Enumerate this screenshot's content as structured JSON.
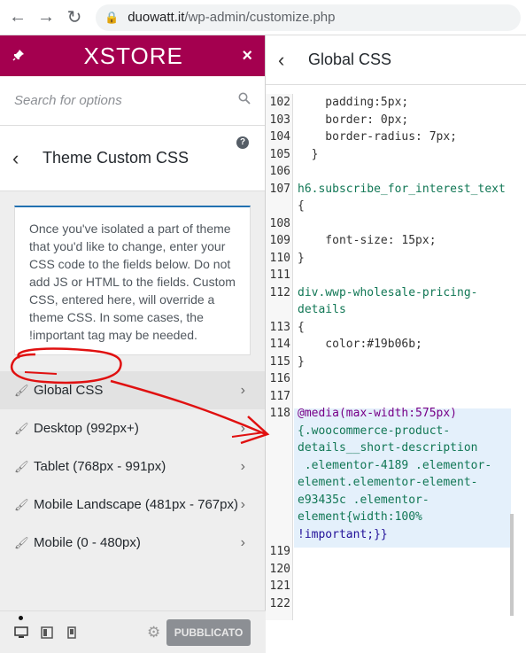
{
  "browser": {
    "back_icon": "←",
    "forward_icon": "→",
    "reload_icon": "↻",
    "domain": "duowatt.it",
    "path": "/wp-admin/customize.php"
  },
  "brand": {
    "logo": "XSTORE",
    "pin_icon": "pin-icon",
    "close_icon": "×",
    "color": "#a4004f"
  },
  "search": {
    "placeholder": "Search for options"
  },
  "section": {
    "back": "‹",
    "title": "Theme Custom CSS",
    "help": "?"
  },
  "description": "Once you've isolated a part of theme that you'd like to change, enter your CSS code to the fields below. Do not add JS or HTML to the fields. Custom CSS, entered here, will override a theme CSS. In some cases, the !important tag may be needed.",
  "menu": [
    {
      "label": "Global CSS"
    },
    {
      "label": "Desktop (992px+)"
    },
    {
      "label": "Tablet (768px - 991px)"
    },
    {
      "label": "Mobile Landscape (481px - 767px)"
    },
    {
      "label": "Mobile (0 - 480px)"
    }
  ],
  "footer": {
    "publish_label": "PUBBLICATO"
  },
  "right": {
    "back": "‹",
    "title": "Global CSS"
  },
  "editor": {
    "line_numbers": [
      "102",
      "103",
      "104",
      "105",
      "106",
      "107",
      "",
      "108",
      "109",
      "110",
      "111",
      "112",
      "",
      "113",
      "114",
      "115",
      "116",
      "117",
      "118",
      "",
      "",
      "",
      "",
      "",
      "",
      "",
      "119",
      "120",
      "121",
      "122"
    ],
    "l102": "    padding:5px;",
    "l103": "    border: 0px;",
    "l104": "    border-radius: 7px;",
    "l105": "  }",
    "l107a": "h6.subscribe_for_interest_text",
    "l107b": "{",
    "l109": "    font-size: 15px;",
    "l110": "}",
    "l112a": "div.wwp-wholesale-pricing-",
    "l112b": "details",
    "l113": "{",
    "l114": "    color:#19b06b;",
    "l115": "}",
    "l118a": "@media(max-width:575px)",
    "l118b": "{.woocommerce-product-",
    "l118c": "details__short-description",
    "l118d": " .elementor-4189 .elementor-",
    "l118e": "element.elementor-element-",
    "l118f": "e93435c .elementor-",
    "l118g": "element{width:100%",
    "l118h": "!important;}}"
  },
  "colors": {
    "accent": "#2271b1",
    "annotation": "#e01010",
    "highlight": "#e4f0fb"
  }
}
